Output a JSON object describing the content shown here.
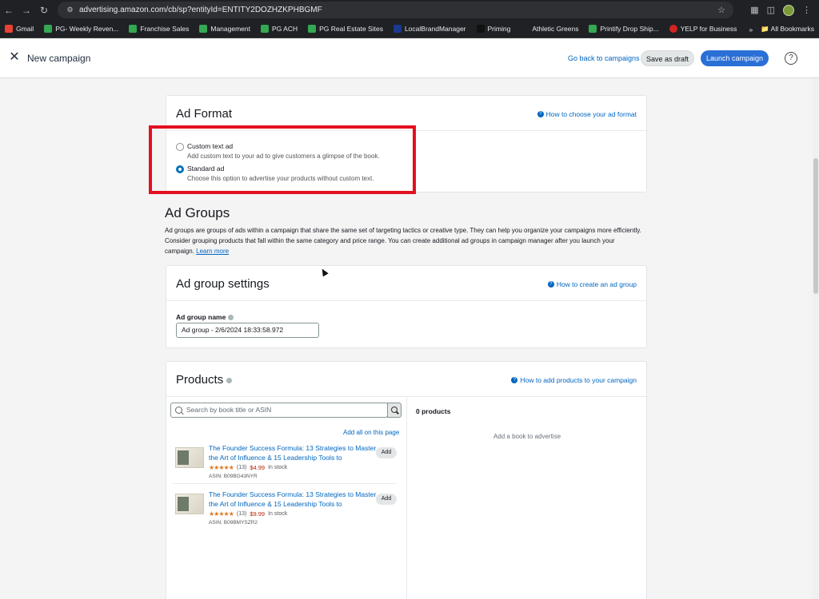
{
  "browser": {
    "url": "advertising.amazon.com/cb/sp?entityId=ENTITY2DOZHZKPHBGMF",
    "bookmarks": [
      {
        "label": "Gmail",
        "color": "#ea4335"
      },
      {
        "label": "PG- Weekly Reven...",
        "color": "#34a853"
      },
      {
        "label": "Franchise Sales",
        "color": "#34a853"
      },
      {
        "label": "Management",
        "color": "#34a853"
      },
      {
        "label": "PG ACH",
        "color": "#34a853"
      },
      {
        "label": "PG Real Estate Sites",
        "color": "#34a853"
      },
      {
        "label": "LocalBrandManager",
        "color": "#1a3a8f"
      },
      {
        "label": "Priming",
        "color": "#111111"
      },
      {
        "label": "Athletic Greens",
        "color": "#202124"
      },
      {
        "label": "Printify Drop Ship...",
        "color": "#34a853"
      },
      {
        "label": "YELP for Business",
        "color": "#d32323"
      }
    ],
    "all_bookmarks": "All Bookmarks"
  },
  "header": {
    "title": "New campaign",
    "go_back": "Go back to campaigns",
    "save_draft": "Save as draft",
    "launch": "Launch campaign",
    "help": "?"
  },
  "ad_format": {
    "title": "Ad Format",
    "help_link": "How to choose your ad format",
    "options": [
      {
        "label": "Custom text ad",
        "desc": "Add custom text to your ad to give customers a glimpse of the book.",
        "selected": false
      },
      {
        "label": "Standard ad",
        "desc": "Choose this option to advertise your products without custom text.",
        "selected": true
      }
    ]
  },
  "ad_groups": {
    "title": "Ad Groups",
    "desc": "Ad groups are groups of ads within a campaign that share the same set of targeting tactics or creative type. They can help you organize your campaigns more efficiently. Consider grouping products that fall within the same category and price range. You can create additional ad groups in campaign manager after you launch your campaign.",
    "learn_more": "Learn more"
  },
  "ad_group_settings": {
    "title": "Ad group settings",
    "help_link": "How to create an ad group",
    "name_label": "Ad group name",
    "name_value": "Ad group - 2/6/2024 18:33:58.972"
  },
  "products": {
    "title": "Products",
    "help_link": "How to add products to your campaign",
    "search_placeholder": "Search by book title or ASIN",
    "add_all": "Add all on this page",
    "count_label": "0 products",
    "empty_message": "Add a book to advertise",
    "items": [
      {
        "title": "The Founder Success Formula: 13 Strategies to Master the Art of Influence & 15 Leadership Tools to",
        "rating_count": "(13)",
        "price": "$4.99",
        "stock": "In stock",
        "asin": "ASIN: B09BG43NYR",
        "add": "Add"
      },
      {
        "title": "The Founder Success Formula: 13 Strategies to Master the Art of Influence & 15 Leadership Tools to",
        "rating_count": "(13)",
        "price": "$9.99",
        "stock": "In stock",
        "asin": "ASIN: B09BMYSZR2",
        "add": "Add"
      }
    ]
  },
  "colors": {
    "accent": "#2a6fd6",
    "link": "#0066c0",
    "highlight_box": "#e3101f",
    "star": "#de7921",
    "price": "#b12704"
  }
}
